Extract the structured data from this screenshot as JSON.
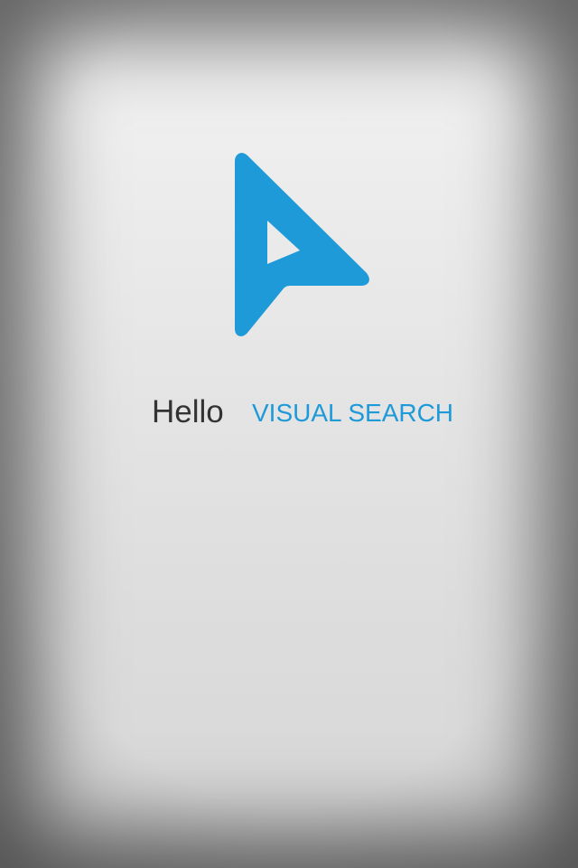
{
  "splash": {
    "greeting": "Hello",
    "app_name": "VISUAL SEARCH",
    "logo_icon": "visual-search-arrow-icon"
  },
  "colors": {
    "brand": "#1e9ad8",
    "greeting_text": "#333333",
    "background": "#e6e6e6"
  }
}
